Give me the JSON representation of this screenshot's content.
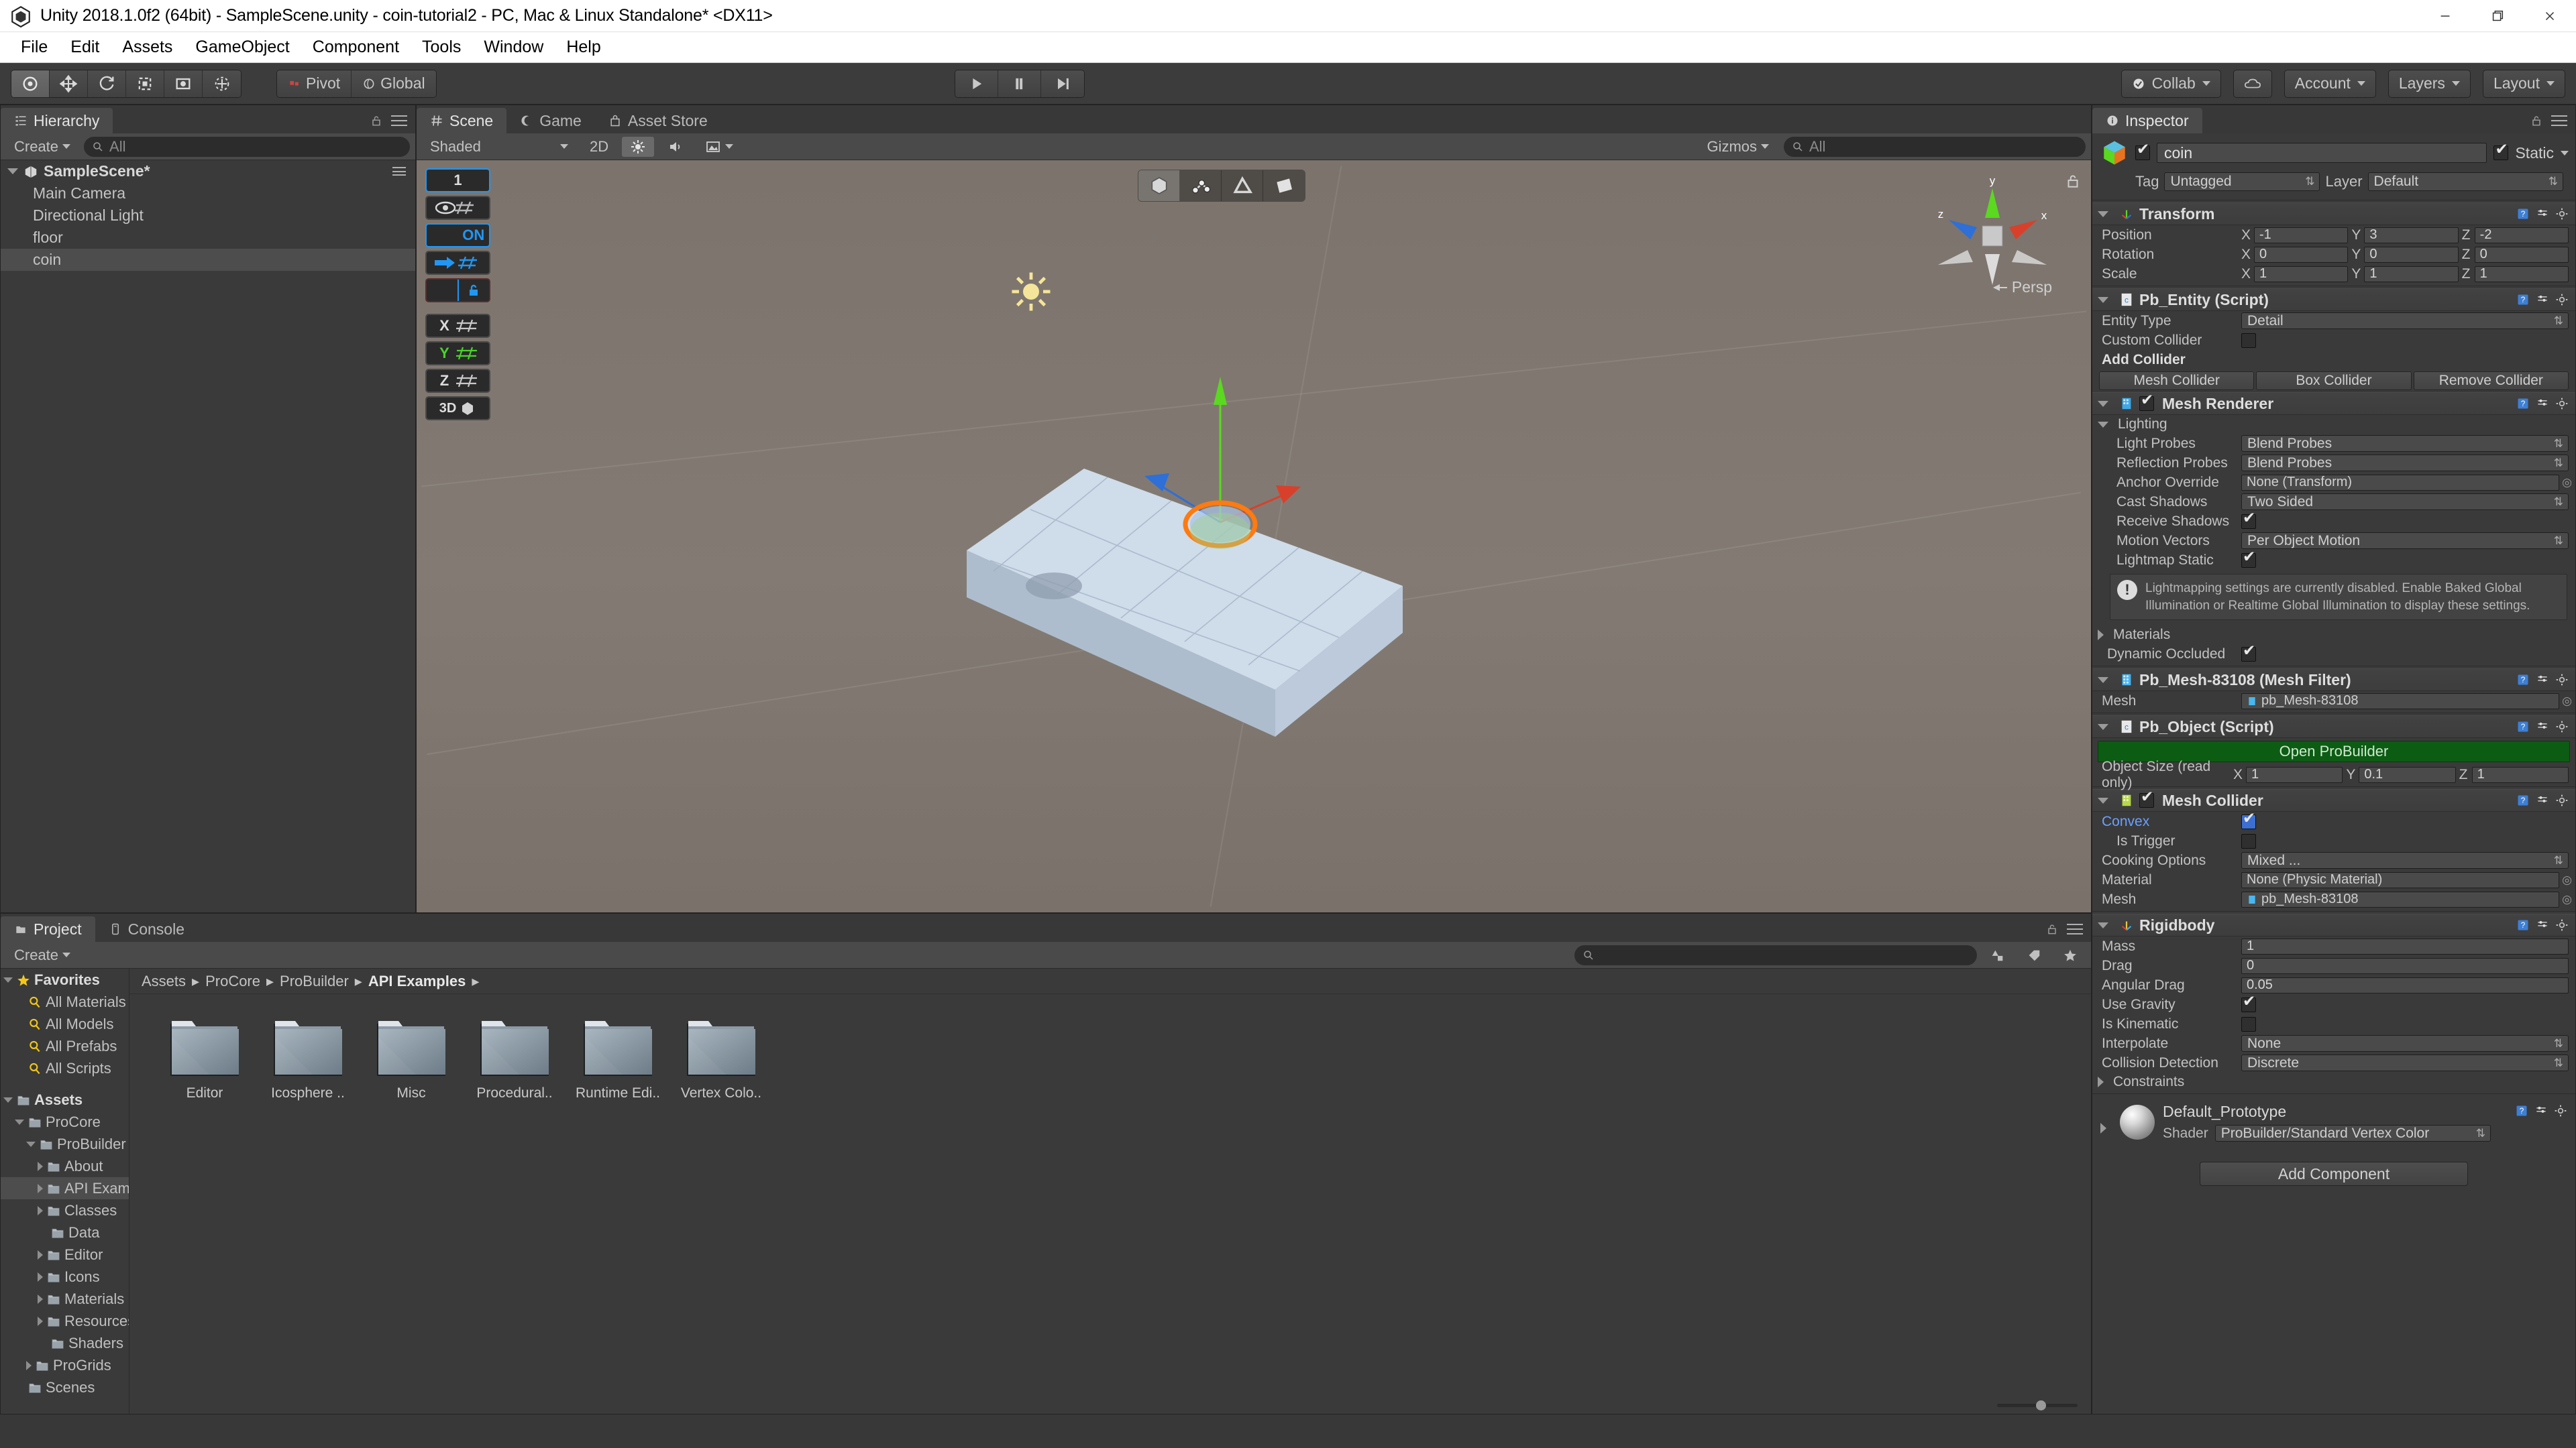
{
  "window": {
    "title": "Unity 2018.1.0f2 (64bit) - SampleScene.unity - coin-tutorial2 - PC, Mac & Linux Standalone* <DX11>",
    "minimize": "—",
    "maximize": "❐",
    "close": "✕"
  },
  "menubar": {
    "items": [
      "File",
      "Edit",
      "Assets",
      "GameObject",
      "Component",
      "Tools",
      "Window",
      "Help"
    ]
  },
  "toolbar": {
    "tools": [
      "hand-tool",
      "move-tool",
      "rotate-tool",
      "scale-tool",
      "rect-tool",
      "transform-tool"
    ],
    "pivot": "Pivot",
    "space": "Global",
    "play": "play",
    "pause": "pause",
    "step": "step",
    "collab": "Collab",
    "cloud": "cloud-icon",
    "account": "Account",
    "layers": "Layers",
    "layout": "Layout"
  },
  "hierarchy": {
    "tab": "Hierarchy",
    "create": "Create",
    "search_placeholder": "All",
    "scene_name": "SampleScene*",
    "objects": [
      {
        "name": "Main Camera",
        "selected": false
      },
      {
        "name": "Directional Light",
        "selected": false
      },
      {
        "name": "floor",
        "selected": false
      },
      {
        "name": "coin",
        "selected": true
      }
    ]
  },
  "scene": {
    "tabs": [
      {
        "label": "Scene",
        "icon": "scene-icon",
        "active": true
      },
      {
        "label": "Game",
        "icon": "game-icon",
        "active": false
      },
      {
        "label": "Asset Store",
        "icon": "store-icon",
        "active": false
      }
    ],
    "draw_mode": "Shaded",
    "mode_2d": "2D",
    "lighting_toggle": "lighting-icon",
    "audio_toggle": "audio-icon",
    "fx_toggle": "effects-icon",
    "gizmos": "Gizmos",
    "search_placeholder": "All",
    "perspective_label": "Persp",
    "gizmo_axes": {
      "x": "x",
      "y": "y",
      "z": "z"
    },
    "progrids": {
      "snap_value": "1",
      "visibility": "eye-grid-icon",
      "on_label": "ON",
      "push_label": "push-grid-icon",
      "lock_label": "lock-grid-icon",
      "axis_x": "X",
      "axis_y": "Y",
      "axis_z": "Z",
      "axis_3d": "3D"
    },
    "element_modes": [
      {
        "name": "object-mode",
        "active": true
      },
      {
        "name": "vertex-mode",
        "active": false
      },
      {
        "name": "edge-mode",
        "active": false
      },
      {
        "name": "face-mode",
        "active": false
      }
    ]
  },
  "project": {
    "tabs": [
      {
        "label": "Project",
        "active": true
      },
      {
        "label": "Console",
        "active": false
      }
    ],
    "create": "Create",
    "search_placeholder": "",
    "breadcrumb": [
      "Assets",
      "ProCore",
      "ProBuilder",
      "API Examples"
    ],
    "tree": [
      {
        "label": "Favorites",
        "depth": 0,
        "arrow": "down",
        "icon": "star",
        "bold": true,
        "selected": false
      },
      {
        "label": "All Materials",
        "depth": 1,
        "arrow": "none",
        "icon": "search",
        "bold": false,
        "selected": false
      },
      {
        "label": "All Models",
        "depth": 1,
        "arrow": "none",
        "icon": "search",
        "bold": false,
        "selected": false
      },
      {
        "label": "All Prefabs",
        "depth": 1,
        "arrow": "none",
        "icon": "search",
        "bold": false,
        "selected": false
      },
      {
        "label": "All Scripts",
        "depth": 1,
        "arrow": "none",
        "icon": "search",
        "bold": false,
        "selected": false
      },
      {
        "label": "",
        "depth": 0,
        "arrow": "none",
        "icon": "none",
        "bold": false,
        "selected": false
      },
      {
        "label": "Assets",
        "depth": 0,
        "arrow": "down",
        "icon": "folder",
        "bold": true,
        "selected": false
      },
      {
        "label": "ProCore",
        "depth": 1,
        "arrow": "down",
        "icon": "folder",
        "bold": false,
        "selected": false
      },
      {
        "label": "ProBuilder",
        "depth": 2,
        "arrow": "down",
        "icon": "folder",
        "bold": false,
        "selected": false
      },
      {
        "label": "About",
        "depth": 3,
        "arrow": "right",
        "icon": "folder",
        "bold": false,
        "selected": false
      },
      {
        "label": "API Examples",
        "depth": 3,
        "arrow": "right",
        "icon": "folder",
        "bold": false,
        "selected": true
      },
      {
        "label": "Classes",
        "depth": 3,
        "arrow": "right",
        "icon": "folder",
        "bold": false,
        "selected": false
      },
      {
        "label": "Data",
        "depth": 3,
        "arrow": "none",
        "icon": "folder",
        "bold": false,
        "selected": false
      },
      {
        "label": "Editor",
        "depth": 3,
        "arrow": "right",
        "icon": "folder",
        "bold": false,
        "selected": false
      },
      {
        "label": "Icons",
        "depth": 3,
        "arrow": "right",
        "icon": "folder",
        "bold": false,
        "selected": false
      },
      {
        "label": "Materials",
        "depth": 3,
        "arrow": "right",
        "icon": "folder",
        "bold": false,
        "selected": false
      },
      {
        "label": "Resources",
        "depth": 3,
        "arrow": "right",
        "icon": "folder",
        "bold": false,
        "selected": false
      },
      {
        "label": "Shaders",
        "depth": 3,
        "arrow": "none",
        "icon": "folder",
        "bold": false,
        "selected": false
      },
      {
        "label": "ProGrids",
        "depth": 2,
        "arrow": "right",
        "icon": "folder",
        "bold": false,
        "selected": false
      },
      {
        "label": "Scenes",
        "depth": 1,
        "arrow": "none",
        "icon": "folder",
        "bold": false,
        "selected": false
      }
    ],
    "folders": [
      "Editor",
      "Icosphere ..",
      "Misc",
      "Procedural..",
      "Runtime Edi..",
      "Vertex Colo.."
    ]
  },
  "inspector": {
    "tab": "Inspector",
    "object_name": "coin",
    "enabled": true,
    "static_label": "Static",
    "static_checked": true,
    "tag_label": "Tag",
    "tag_value": "Untagged",
    "layer_label": "Layer",
    "layer_value": "Default",
    "transform": {
      "title": "Transform",
      "rows": [
        {
          "label": "Position",
          "x": "-1",
          "y": "3",
          "z": "-2"
        },
        {
          "label": "Rotation",
          "x": "0",
          "y": "0",
          "z": "0"
        },
        {
          "label": "Scale",
          "x": "1",
          "y": "1",
          "z": "1"
        }
      ]
    },
    "pb_entity": {
      "title": "Pb_Entity (Script)",
      "entity_type_label": "Entity Type",
      "entity_type_value": "Detail",
      "custom_collider_label": "Custom Collider",
      "custom_collider_checked": false,
      "add_collider_label": "Add Collider",
      "buttons": [
        "Mesh Collider",
        "Box Collider",
        "Remove Collider"
      ]
    },
    "mesh_renderer": {
      "title": "Mesh Renderer",
      "enabled": true,
      "lighting_label": "Lighting",
      "rows": [
        {
          "label": "Light Probes",
          "value": "Blend Probes",
          "type": "dropdown"
        },
        {
          "label": "Reflection Probes",
          "value": "Blend Probes",
          "type": "dropdown"
        },
        {
          "label": "Anchor Override",
          "value": "None (Transform)",
          "type": "object"
        },
        {
          "label": "Cast Shadows",
          "value": "Two Sided",
          "type": "dropdown"
        },
        {
          "label": "Receive Shadows",
          "value": true,
          "type": "checkbox"
        },
        {
          "label": "Motion Vectors",
          "value": "Per Object Motion",
          "type": "dropdown"
        },
        {
          "label": "Lightmap Static",
          "value": true,
          "type": "checkbox"
        }
      ],
      "helpbox": "Lightmapping settings are currently disabled. Enable Baked Global Illumination or Realtime Global Illumination to display these settings.",
      "materials_label": "Materials",
      "dynamic_occluded_label": "Dynamic Occluded",
      "dynamic_occluded_checked": true
    },
    "mesh_filter": {
      "title": "Pb_Mesh-83108 (Mesh Filter)",
      "mesh_label": "Mesh",
      "mesh_value": "pb_Mesh-83108"
    },
    "pb_object": {
      "title": "Pb_Object (Script)",
      "open_button": "Open ProBuilder",
      "size_label": "Object Size (read only)",
      "x": "1",
      "y": "0.1",
      "z": "1"
    },
    "mesh_collider": {
      "title": "Mesh Collider",
      "enabled": true,
      "convex_label": "Convex",
      "convex_checked": true,
      "is_trigger_label": "Is Trigger",
      "is_trigger_checked": false,
      "cooking_label": "Cooking Options",
      "cooking_value": "Mixed ...",
      "material_label": "Material",
      "material_value": "None (Physic Material)",
      "mesh_label": "Mesh",
      "mesh_value": "pb_Mesh-83108"
    },
    "rigidbody": {
      "title": "Rigidbody",
      "mass_label": "Mass",
      "mass_value": "1",
      "drag_label": "Drag",
      "drag_value": "0",
      "angular_drag_label": "Angular Drag",
      "angular_drag_value": "0.05",
      "use_gravity_label": "Use Gravity",
      "use_gravity_checked": true,
      "is_kinematic_label": "Is Kinematic",
      "is_kinematic_checked": false,
      "interpolate_label": "Interpolate",
      "interpolate_value": "None",
      "collision_label": "Collision Detection",
      "collision_value": "Discrete",
      "constraints_label": "Constraints"
    },
    "material": {
      "name": "Default_Prototype",
      "shader_label": "Shader",
      "shader_value": "ProBuilder/Standard Vertex Color"
    },
    "add_component": "Add Component"
  },
  "colors": {
    "accent_blue": "#2196f3",
    "probuilder_green": "#0c5c13",
    "axis_x": "#d9402b",
    "axis_y": "#5bd820",
    "axis_z": "#2e6fd8",
    "selection_orange": "#ff7a10",
    "panel_bg": "#383838"
  }
}
